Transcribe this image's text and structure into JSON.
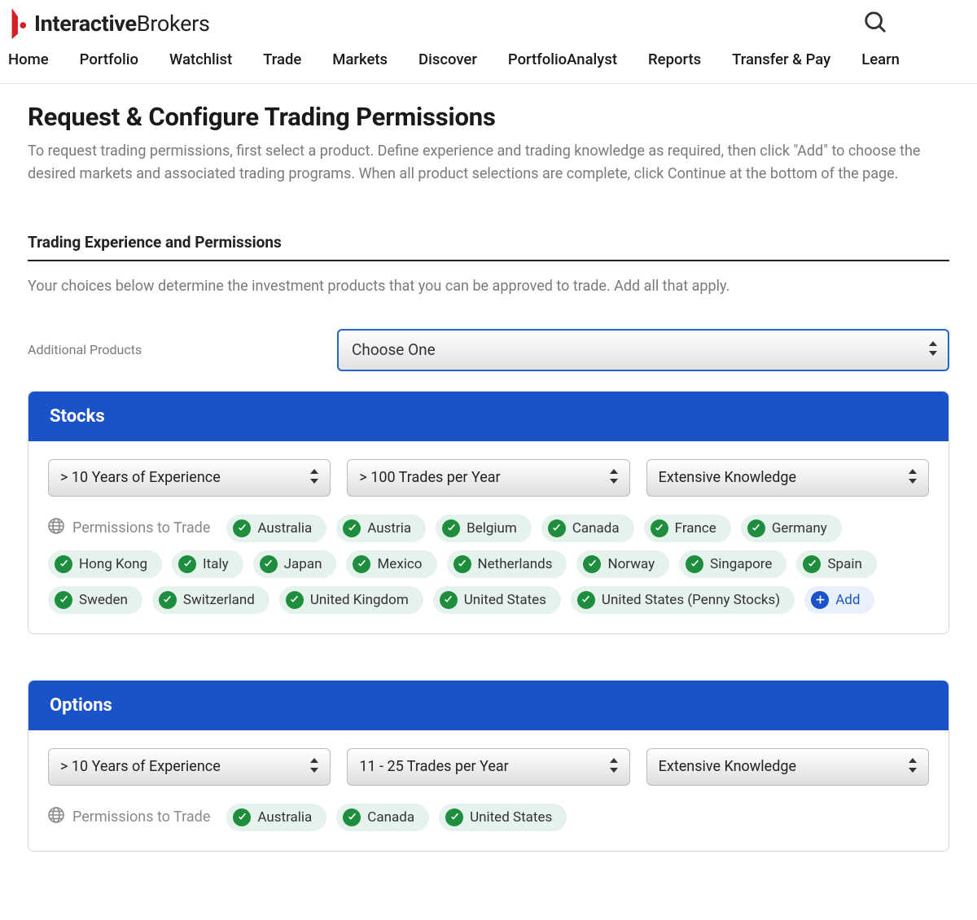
{
  "brand": {
    "bold": "Interactive",
    "light": "Brokers"
  },
  "nav": {
    "items": [
      "Home",
      "Portfolio",
      "Watchlist",
      "Trade",
      "Markets",
      "Discover",
      "PortfolioAnalyst",
      "Reports",
      "Transfer & Pay",
      "Learn"
    ]
  },
  "page": {
    "title": "Request & Configure Trading Permissions",
    "description": "To request trading permissions, first select a product. Define experience and trading knowledge as required, then click \"Add\" to choose the desired markets and associated trading programs. When all product selections are complete, click Continue at the bottom of the page."
  },
  "section": {
    "title": "Trading Experience and Permissions",
    "description": "Your choices below determine the investment products that you can be approved to trade. Add all that apply."
  },
  "additional": {
    "label": "Additional Products",
    "placeholder": "Choose One"
  },
  "labels": {
    "permissions": "Permissions to Trade",
    "add": "Add"
  },
  "panels": [
    {
      "title": "Stocks",
      "experience": "> 10 Years of Experience",
      "trades": "> 100 Trades per Year",
      "knowledge": "Extensive Knowledge",
      "countries": [
        "Australia",
        "Austria",
        "Belgium",
        "Canada",
        "France",
        "Germany",
        "Hong Kong",
        "Italy",
        "Japan",
        "Mexico",
        "Netherlands",
        "Norway",
        "Singapore",
        "Spain",
        "Sweden",
        "Switzerland",
        "United Kingdom",
        "United States",
        "United States (Penny Stocks)"
      ],
      "showAdd": true
    },
    {
      "title": "Options",
      "experience": "> 10 Years of Experience",
      "trades": "11 - 25 Trades per Year",
      "knowledge": "Extensive Knowledge",
      "countries": [
        "Australia",
        "Canada",
        "United States"
      ],
      "showAdd": false
    }
  ]
}
